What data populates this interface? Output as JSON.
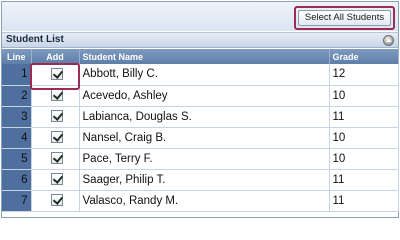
{
  "toolbar": {
    "select_all_label": "Select All Students"
  },
  "panel": {
    "title": "Student List"
  },
  "columns": {
    "line": "Line",
    "add": "Add",
    "name": "Student Name",
    "grade": "Grade"
  },
  "icons": {
    "collapse": "collapse-up-icon",
    "checkbox": "checkbox-checked-icon"
  },
  "colors": {
    "highlight": "#9c2c52",
    "header_blue": "#5d7ea8",
    "line_cell": "#4f6f9f"
  },
  "students": [
    {
      "line": "1",
      "checked": true,
      "name": "Abbott, Billy C.",
      "grade": "12"
    },
    {
      "line": "2",
      "checked": true,
      "name": "Acevedo, Ashley",
      "grade": "10"
    },
    {
      "line": "3",
      "checked": true,
      "name": "Labianca, Douglas S.",
      "grade": "11"
    },
    {
      "line": "4",
      "checked": true,
      "name": "Nansel, Craig B.",
      "grade": "10"
    },
    {
      "line": "5",
      "checked": true,
      "name": "Pace, Terry F.",
      "grade": "10"
    },
    {
      "line": "6",
      "checked": true,
      "name": "Saager, Philip T.",
      "grade": "11"
    },
    {
      "line": "7",
      "checked": true,
      "name": "Valasco, Randy M.",
      "grade": "11"
    }
  ]
}
